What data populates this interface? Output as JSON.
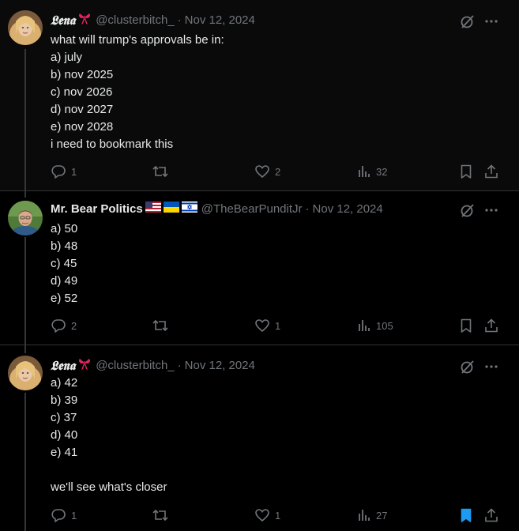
{
  "tweets": [
    {
      "display_name": "𝕷𝖊𝖓𝖆",
      "handle": "@clusterbitch_",
      "separator": "·",
      "date": "Nov 12, 2024",
      "body": [
        "what will trump's approvals be in:",
        "a) july",
        "b) nov 2025",
        "c) nov 2026",
        "d) nov 2027",
        "e) nov 2028",
        "i need to bookmark this"
      ],
      "replies": "1",
      "retweets": "",
      "likes": "2",
      "views": "32",
      "bookmarked": false
    },
    {
      "display_name": "Mr. Bear Politics",
      "handle": "@TheBearPunditJr",
      "separator": "·",
      "date": "Nov 12, 2024",
      "body": [
        "a) 50",
        "b) 48",
        "c) 45",
        "d) 49",
        "e) 52"
      ],
      "replies": "2",
      "retweets": "",
      "likes": "1",
      "views": "105",
      "bookmarked": false
    },
    {
      "display_name": "𝕷𝖊𝖓𝖆",
      "handle": "@clusterbitch_",
      "separator": "·",
      "date": "Nov 12, 2024",
      "body": [
        "a) 42",
        "b) 39",
        "c) 37",
        "d) 40",
        "e) 41",
        "",
        "we'll see what's closer"
      ],
      "replies": "1",
      "retweets": "",
      "likes": "1",
      "views": "27",
      "bookmarked": true
    }
  ],
  "icons": {
    "reply": "reply-icon",
    "retweet": "retweet-icon",
    "like": "heart-icon",
    "views": "views-icon",
    "bookmark": "bookmark-icon",
    "share": "share-icon",
    "grok": "grok-icon",
    "more": "more-icon"
  },
  "colors": {
    "text": "#e7e9ea",
    "muted": "#71767b",
    "bookmark_active": "#1d9bf0",
    "divider": "#2f3336"
  }
}
